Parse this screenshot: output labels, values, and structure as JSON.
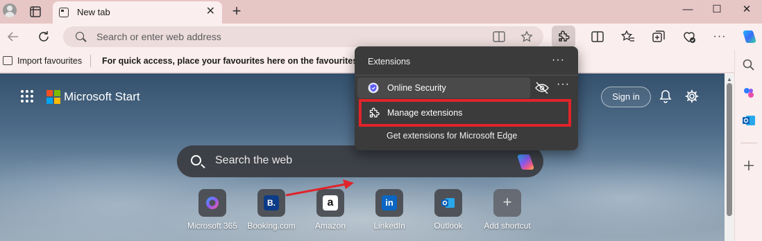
{
  "tabstrip": {
    "tab_title": "New tab",
    "close_glyph": "✕",
    "new_tab_glyph": "+",
    "window_controls": {
      "minimize": "—",
      "maximize": "☐",
      "close": "✕"
    }
  },
  "toolbar": {
    "address_placeholder": "Search or enter web address"
  },
  "favourites_bar": {
    "import_label": "Import favourites",
    "hint": "For quick access, place your favourites here on the favourites bar. L"
  },
  "newtab_page": {
    "brand": "Microsoft Start",
    "sign_in": "Sign in",
    "search_placeholder": "Search the web",
    "shortcuts": [
      {
        "label": "Microsoft 365",
        "icon": "microsoft-365-icon"
      },
      {
        "label": "Booking.com",
        "icon": "booking-icon",
        "glyph": "B."
      },
      {
        "label": "Amazon",
        "icon": "amazon-icon",
        "glyph": "a"
      },
      {
        "label": "LinkedIn",
        "icon": "linkedin-icon",
        "glyph": "in"
      },
      {
        "label": "Outlook",
        "icon": "outlook-icon"
      },
      {
        "label": "Add shortcut",
        "icon": "plus-icon",
        "glyph": "+"
      }
    ]
  },
  "extensions_popup": {
    "title": "Extensions",
    "more_glyph": "···",
    "installed": [
      {
        "name": "Online Security",
        "icon": "shield-icon"
      }
    ],
    "manage_label": "Manage extensions",
    "get_label": "Get extensions for Microsoft Edge"
  },
  "colors": {
    "tabstrip_bg": "#e7c6c6",
    "toolbar_bg": "#fbeeee",
    "popup_bg": "#3b3b3b",
    "highlight_red": "#e0242b"
  }
}
